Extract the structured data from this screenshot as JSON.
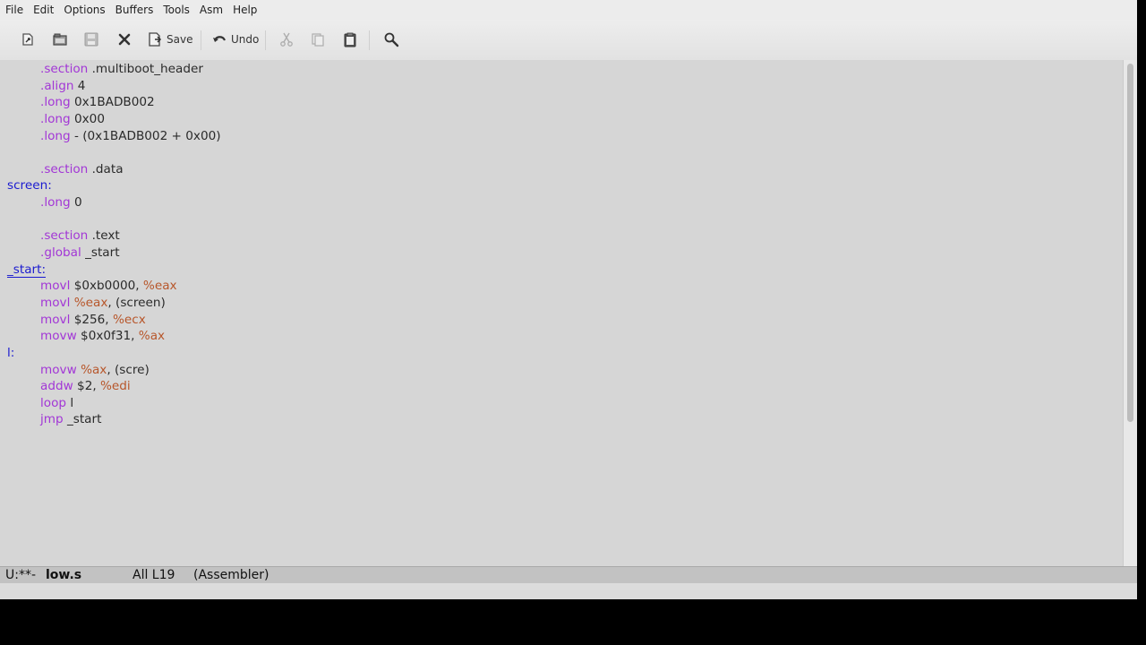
{
  "menubar": {
    "items": [
      "File",
      "Edit",
      "Options",
      "Buffers",
      "Tools",
      "Asm",
      "Help"
    ]
  },
  "toolbar": {
    "save_label": "Save",
    "undo_label": "Undo",
    "icons": [
      "new-file-icon",
      "open-folder-icon",
      "save-disk-icon",
      "close-buffer-icon",
      "save-icon",
      "undo-icon",
      "cut-icon",
      "copy-icon",
      "paste-icon",
      "search-icon"
    ]
  },
  "editor": {
    "lines": [
      {
        "indent": true,
        "segments": [
          {
            "cls": "kw",
            "text": ".section"
          },
          {
            "cls": "",
            "text": " .multiboot_header"
          }
        ]
      },
      {
        "indent": true,
        "segments": [
          {
            "cls": "kw",
            "text": ".align"
          },
          {
            "cls": "",
            "text": " 4"
          }
        ]
      },
      {
        "indent": true,
        "segments": [
          {
            "cls": "kw",
            "text": ".long"
          },
          {
            "cls": "",
            "text": " 0x1BADB002"
          }
        ]
      },
      {
        "indent": true,
        "segments": [
          {
            "cls": "kw",
            "text": ".long"
          },
          {
            "cls": "",
            "text": " 0x00"
          }
        ]
      },
      {
        "indent": true,
        "segments": [
          {
            "cls": "kw",
            "text": ".long"
          },
          {
            "cls": "",
            "text": " - (0x1BADB002 + 0x00)"
          }
        ]
      },
      {
        "indent": false,
        "segments": []
      },
      {
        "indent": true,
        "segments": [
          {
            "cls": "kw",
            "text": ".section"
          },
          {
            "cls": "",
            "text": " .data"
          }
        ]
      },
      {
        "indent": false,
        "segments": [
          {
            "cls": "lab",
            "text": "screen:"
          }
        ]
      },
      {
        "indent": true,
        "segments": [
          {
            "cls": "kw",
            "text": ".long"
          },
          {
            "cls": "",
            "text": " 0"
          }
        ]
      },
      {
        "indent": false,
        "segments": []
      },
      {
        "indent": true,
        "segments": [
          {
            "cls": "kw",
            "text": ".section"
          },
          {
            "cls": "",
            "text": " .text"
          }
        ]
      },
      {
        "indent": true,
        "segments": [
          {
            "cls": "kw",
            "text": ".global"
          },
          {
            "cls": "",
            "text": " _start"
          }
        ]
      },
      {
        "indent": false,
        "segments": [
          {
            "cls": "lab cursor-mark",
            "text": "_start:"
          }
        ]
      },
      {
        "indent": true,
        "segments": [
          {
            "cls": "kw",
            "text": "movl"
          },
          {
            "cls": "",
            "text": " $0xb0000, "
          },
          {
            "cls": "reg",
            "text": "%eax"
          }
        ]
      },
      {
        "indent": true,
        "segments": [
          {
            "cls": "kw",
            "text": "movl"
          },
          {
            "cls": "",
            "text": " "
          },
          {
            "cls": "reg",
            "text": "%eax"
          },
          {
            "cls": "",
            "text": ", (screen)"
          }
        ]
      },
      {
        "indent": true,
        "segments": [
          {
            "cls": "kw",
            "text": "movl"
          },
          {
            "cls": "",
            "text": " $256, "
          },
          {
            "cls": "reg",
            "text": "%ecx"
          }
        ]
      },
      {
        "indent": true,
        "segments": [
          {
            "cls": "kw",
            "text": "movw"
          },
          {
            "cls": "",
            "text": " $0x0f31, "
          },
          {
            "cls": "reg",
            "text": "%ax"
          }
        ]
      },
      {
        "indent": false,
        "segments": [
          {
            "cls": "lab",
            "text": "l:"
          }
        ]
      },
      {
        "indent": true,
        "segments": [
          {
            "cls": "kw",
            "text": "movw"
          },
          {
            "cls": "",
            "text": " "
          },
          {
            "cls": "reg",
            "text": "%ax"
          },
          {
            "cls": "",
            "text": ", (scre)"
          }
        ]
      },
      {
        "indent": true,
        "segments": [
          {
            "cls": "kw",
            "text": "addw"
          },
          {
            "cls": "",
            "text": " $2, "
          },
          {
            "cls": "reg",
            "text": "%edi"
          }
        ]
      },
      {
        "indent": true,
        "segments": [
          {
            "cls": "kw",
            "text": "loop"
          },
          {
            "cls": "",
            "text": " l"
          }
        ]
      },
      {
        "indent": true,
        "segments": [
          {
            "cls": "kw",
            "text": "jmp"
          },
          {
            "cls": "",
            "text": " _start"
          }
        ]
      }
    ]
  },
  "modeline": {
    "status": "U:**-",
    "buffer_name": "low.s",
    "position": "All L19",
    "mode": "(Assembler)"
  },
  "minibuffer": {
    "text": ""
  },
  "colors": {
    "keyword": "#a236d6",
    "register": "#b7562a",
    "label": "#1b1bd0",
    "background": "#d6d6d6"
  }
}
